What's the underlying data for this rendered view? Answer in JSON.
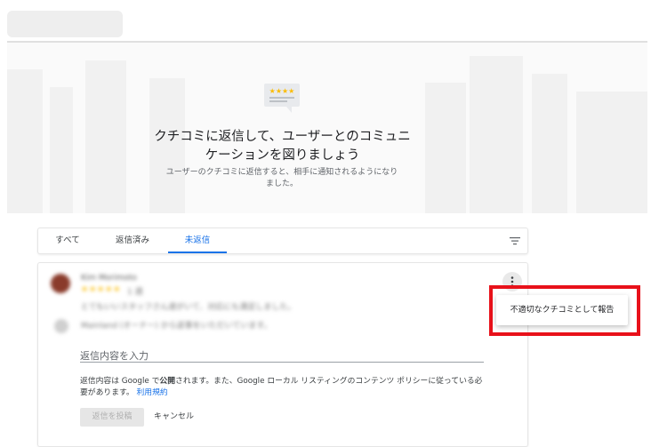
{
  "hero": {
    "title": "クチコミに返信して、ユーザーとのコミュニケーションを図りましょう",
    "subtitle": "ユーザーのクチコミに返信すると、相手に通知されるようになりました。",
    "icon": "review-stars-icon"
  },
  "tabs": [
    {
      "label": "すべて",
      "active": false
    },
    {
      "label": "返信済み",
      "active": false
    },
    {
      "label": "未返信",
      "active": true
    }
  ],
  "filter_icon": "filter-icon",
  "review": {
    "author_blurred": "Kim Morimoto",
    "rating": "★★★★★",
    "time_blurred": "1 週",
    "text_blurred": "とてもいいスタッフさん達がいて、対応にも満足しました。",
    "owner_note_blurred": "Mainland (オーナー) から返事をいただいています。"
  },
  "more_icon": "more-vert-icon",
  "reply": {
    "label": "返信内容を入力",
    "policy_prefix": "返信内容は Google で",
    "policy_bold": "公開",
    "policy_suffix": "されます。また、Google ローカル リスティングのコンテンツ ポリシーに従っている必要があります。",
    "policy_link": "利用規約",
    "post_button": "返信を投稿",
    "cancel_button": "キャンセル"
  },
  "menu": {
    "report_label": "不適切なクチコミとして報告"
  },
  "colors": {
    "accent": "#1a73e8",
    "highlight": "#e8111a",
    "star": "#fbbc04"
  }
}
